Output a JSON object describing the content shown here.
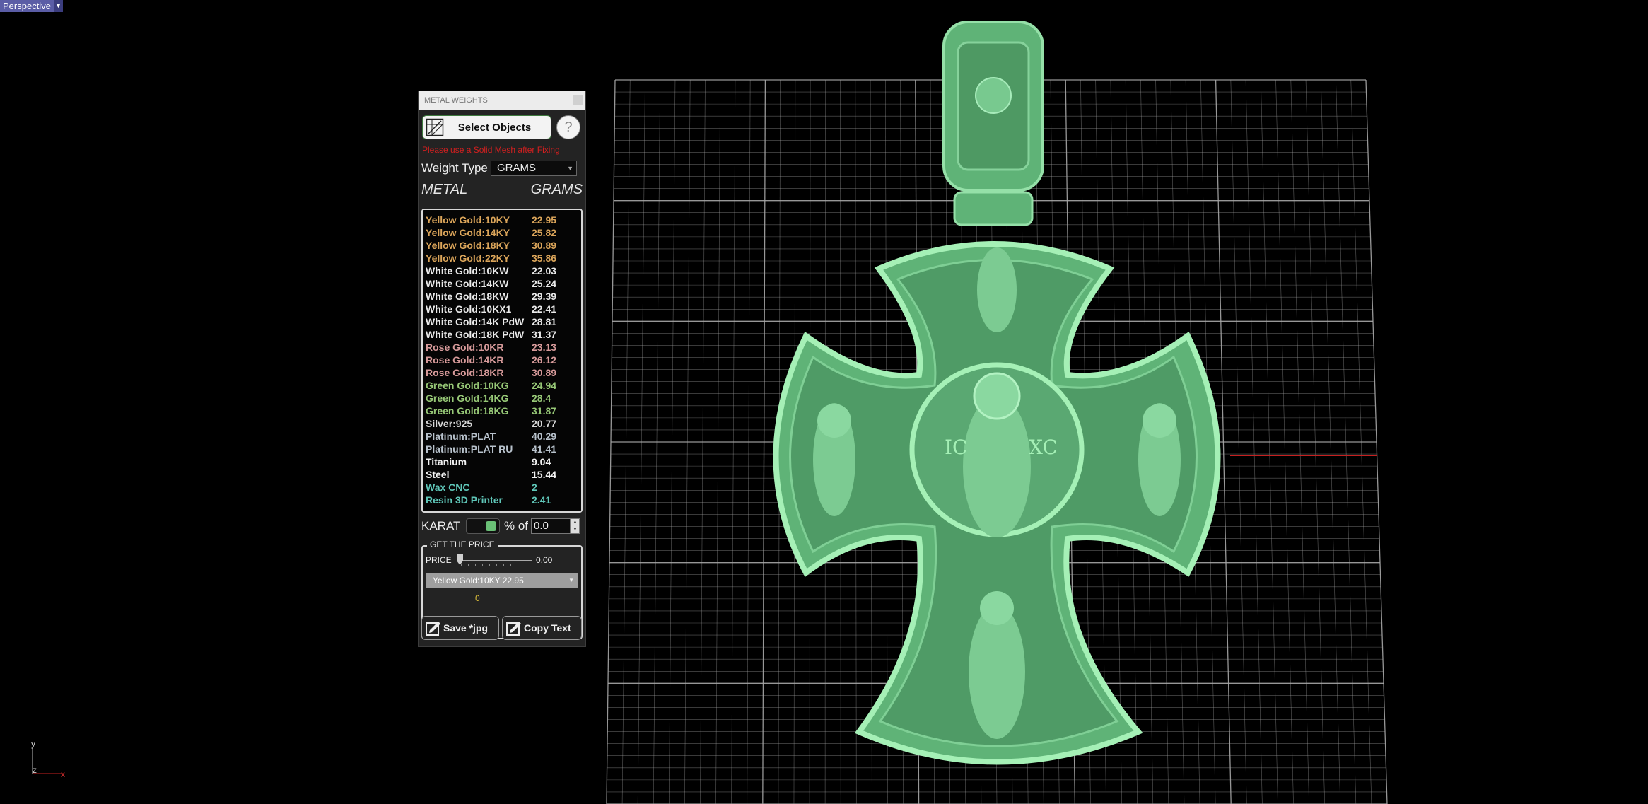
{
  "viewport": {
    "label": "Perspective",
    "axis_y": "y",
    "axis_z": "z",
    "axis_x": "x",
    "model_color": "#6fc487",
    "grid_color": "#a8a8a8"
  },
  "panel": {
    "title": "METAL WEIGHTS",
    "select_button": "Select Objects",
    "help_button": "?",
    "warning": "Please use a Solid Mesh after Fixing",
    "weight_type_label": "Weight Type",
    "weight_type_value": "GRAMS",
    "metal_header": "METAL",
    "grams_header": "GRAMS",
    "metals": [
      {
        "name": "Yellow Gold:10KY",
        "value": "22.95",
        "color": "#dba55a"
      },
      {
        "name": "Yellow Gold:14KY",
        "value": "25.82",
        "color": "#dba55a"
      },
      {
        "name": "Yellow Gold:18KY",
        "value": "30.89",
        "color": "#dba55a"
      },
      {
        "name": "Yellow Gold:22KY",
        "value": "35.86",
        "color": "#dba55a"
      },
      {
        "name": "White Gold:10KW",
        "value": "22.03",
        "color": "#e9e9e9"
      },
      {
        "name": "White Gold:14KW",
        "value": "25.24",
        "color": "#e9e9e9"
      },
      {
        "name": "White Gold:18KW",
        "value": "29.39",
        "color": "#e9e9e9"
      },
      {
        "name": "White Gold:10KX1",
        "value": "22.41",
        "color": "#e9e9e9"
      },
      {
        "name": "White Gold:14K PdW",
        "value": "28.81",
        "color": "#e9e9e9"
      },
      {
        "name": "White Gold:18K PdW",
        "value": "31.37",
        "color": "#e9e9e9"
      },
      {
        "name": "Rose Gold:10KR",
        "value": "23.13",
        "color": "#d79a9a"
      },
      {
        "name": "Rose Gold:14KR",
        "value": "26.12",
        "color": "#d79a9a"
      },
      {
        "name": "Rose Gold:18KR",
        "value": "30.89",
        "color": "#d79a9a"
      },
      {
        "name": "Green Gold:10KG",
        "value": "24.94",
        "color": "#96c776"
      },
      {
        "name": "Green Gold:14KG",
        "value": "28.4",
        "color": "#96c776"
      },
      {
        "name": "Green Gold:18KG",
        "value": "31.87",
        "color": "#96c776"
      },
      {
        "name": "Silver:925",
        "value": "20.77",
        "color": "#d6d6d6"
      },
      {
        "name": "Platinum:PLAT",
        "value": "40.29",
        "color": "#b8c2cc"
      },
      {
        "name": "Platinum:PLAT RU",
        "value": "41.41",
        "color": "#b8c2cc"
      },
      {
        "name": "Titanium",
        "value": "9.04",
        "color": "#f2f2f2"
      },
      {
        "name": "Steel",
        "value": "15.44",
        "color": "#f2f2f2"
      },
      {
        "name": "Wax  CNC",
        "value": "2",
        "color": "#5fc6b8"
      },
      {
        "name": "Resin 3D Printer",
        "value": "2.41",
        "color": "#5fc6b8"
      }
    ],
    "karat_label": "KARAT",
    "percent_label": "% of",
    "percent_value": "0.0",
    "price_group_title": "GET THE PRICE",
    "price_label": "PRICE",
    "price_value": "0.00",
    "price_slider_level": 0,
    "price_metal_select": "Yellow Gold:10KY 22.95",
    "price_result": "0",
    "save_button": "Save *jpg",
    "copy_button": "Copy Text"
  }
}
